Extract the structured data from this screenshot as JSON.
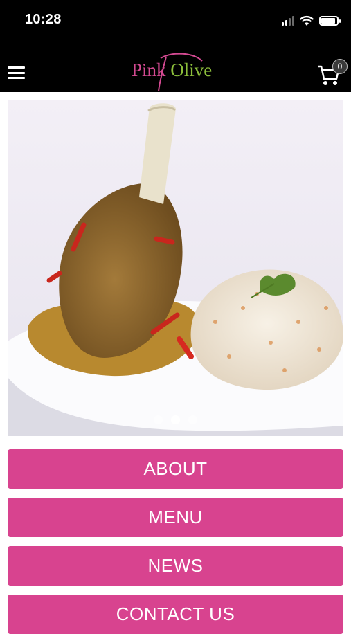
{
  "status": {
    "time": "10:28"
  },
  "header": {
    "logo_part1": "Pink",
    "logo_part2": "Olive",
    "cart_count": "0",
    "brand_colors": {
      "pink": "#d44a92",
      "olive": "#8bbd3b"
    }
  },
  "carousel": {
    "slide_count": 3,
    "active_index": 1
  },
  "menu_buttons": [
    {
      "label": "ABOUT"
    },
    {
      "label": "MENU"
    },
    {
      "label": "NEWS"
    },
    {
      "label": "CONTACT US"
    }
  ],
  "colors": {
    "accent": "#d8438f",
    "header_bg": "#000000"
  },
  "icons": [
    "hamburger-icon",
    "shopping-cart-icon",
    "signal-icon",
    "wifi-icon",
    "battery-icon"
  ]
}
